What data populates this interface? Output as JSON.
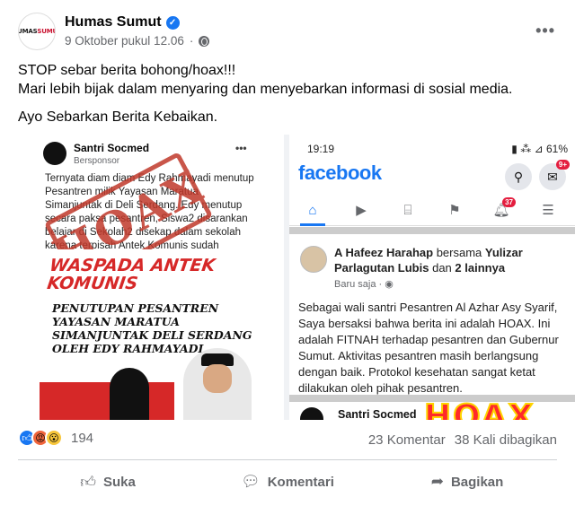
{
  "post": {
    "author": "Humas Sumut",
    "logo_text_a": "HUMAS",
    "logo_text_b": "SUMUT",
    "timestamp": "9 Oktober pukul 12.06",
    "text_lines": [
      "STOP sebar berita bohong/hoax!!!",
      "Mari lebih bijak dalam menyaring dan menyebarkan informasi di sosial media.",
      "Ayo Sebarkan Berita Kebaikan."
    ]
  },
  "left_image": {
    "name": "Santri Socmed",
    "sponsor": "Bersponsor",
    "more": "•••",
    "body": "Ternyata diam diam Edy Rahmayadi menutup Pesantren milik Yayasan Maratua Simanjuntak di Deli Serdang. Edy menutup secara paksa pesantren, Siswa2 disarankan belajar di Sekolah2 disekap dalam sekolah karena terpisah Antek Komunis sudah semakin ?! Waspadalah!",
    "stamp": "HOAX",
    "headline": "WASPADA ANTEK KOMUNIS",
    "subheadline": "PENUTUPAN PESANTREN YAYASAN MARATUA SIMANJUNTAK DELI SERDANG OLEH EDY RAHMAYADI"
  },
  "right_image": {
    "status_time": "19:19",
    "status_right": "61%",
    "brand": "facebook",
    "messenger_badge": "9+",
    "notif_badge": "37",
    "author_line": "A Hafeez Harahap",
    "author_with": "bersama",
    "author_tagged": "Yulizar Parlagutan Lubis",
    "author_and": "dan",
    "author_others": "2 lainnya",
    "time": "Baru saja",
    "body": "Sebagai wali santri Pesantren Al Azhar Asy Syarif, Saya bersaksi bahwa berita ini adalah HOAX. Ini adalah FITNAH terhadap pesantren dan Gubernur Sumut. Aktivitas pesantren masih berlangsung dengan baik. Protokol kesehatan sangat ketat dilakukan oleh pihak pesantren.",
    "bottom_name": "Santri Socmed",
    "bottom_stamp": "HOAX"
  },
  "stats": {
    "reaction_count": "194",
    "comments": "23 Komentar",
    "shares": "38 Kali dibagikan"
  },
  "actions": {
    "like": "Suka",
    "comment": "Komentari",
    "share": "Bagikan"
  }
}
